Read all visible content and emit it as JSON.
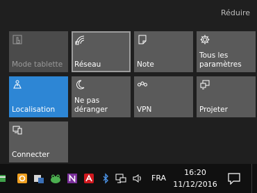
{
  "action_center": {
    "collapse_label": "Réduire",
    "tiles": [
      {
        "label": "Mode tablette",
        "icon": "tablet-mode-icon",
        "state": "disabled"
      },
      {
        "label": "Réseau",
        "icon": "network-icon",
        "state": "hovered"
      },
      {
        "label": "Note",
        "icon": "note-icon",
        "state": "normal"
      },
      {
        "label": "Tous les\nparamètres",
        "icon": "settings-gear-icon",
        "state": "normal"
      },
      {
        "label": "Localisation",
        "icon": "location-icon",
        "state": "active"
      },
      {
        "label": "Ne pas\ndéranger",
        "icon": "moon-icon",
        "state": "normal"
      },
      {
        "label": "VPN",
        "icon": "vpn-icon",
        "state": "normal"
      },
      {
        "label": "Projeter",
        "icon": "project-icon",
        "state": "normal"
      },
      {
        "label": "Connecter",
        "icon": "connect-icon",
        "state": "normal"
      }
    ]
  },
  "taskbar": {
    "language": "FRA",
    "time": "16:20",
    "date": "11/12/2016",
    "apps": [
      {
        "icon": "pinned-app-icon"
      },
      {
        "icon": "outlook-icon"
      },
      {
        "icon": "camera-app-icon"
      },
      {
        "icon": "frog-app-icon"
      },
      {
        "icon": "onenote-icon"
      },
      {
        "icon": "avira-icon"
      },
      {
        "icon": "bluetooth-icon"
      }
    ],
    "tray": [
      {
        "icon": "network-tray-icon"
      },
      {
        "icon": "volume-icon"
      }
    ],
    "notification_icon": "notification-center-icon"
  },
  "colors": {
    "background": "#1f1f1f",
    "tile": "#5a5a5a",
    "tile_disabled": "#4b4b4b",
    "tile_active": "#2d86d5",
    "taskbar": "#101010"
  }
}
